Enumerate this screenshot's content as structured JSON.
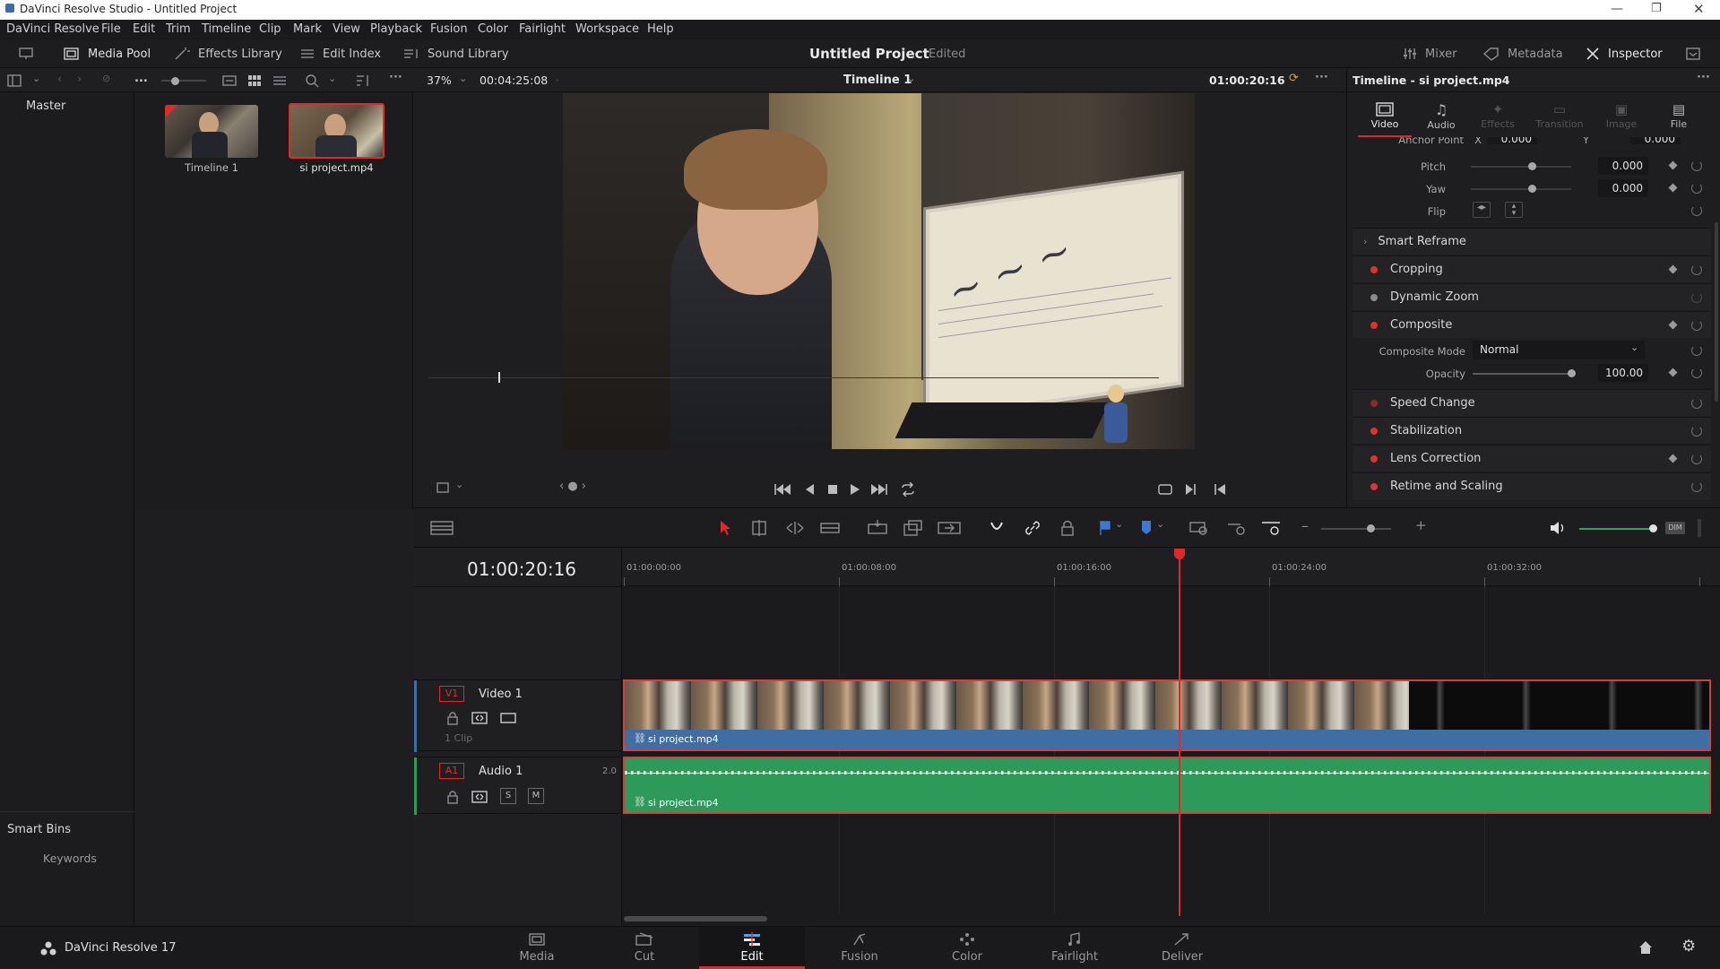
{
  "window": {
    "title": "DaVinci Resolve Studio - Untitled Project"
  },
  "menu": [
    "DaVinci Resolve",
    "File",
    "Edit",
    "Trim",
    "Timeline",
    "Clip",
    "Mark",
    "View",
    "Playback",
    "Fusion",
    "Color",
    "Fairlight",
    "Workspace",
    "Help"
  ],
  "toolbar": {
    "media_pool": "Media Pool",
    "effects_library": "Effects Library",
    "edit_index": "Edit Index",
    "sound_library": "Sound Library",
    "project_title": "Untitled Project",
    "project_status": "Edited",
    "mixer": "Mixer",
    "metadata": "Metadata",
    "inspector": "Inspector"
  },
  "media_pool": {
    "ellipsis": "...",
    "master_bin": "Master",
    "clips": [
      {
        "name": "Timeline 1"
      },
      {
        "name": "si project.mp4"
      }
    ],
    "smart_bins": "Smart Bins",
    "keywords": "Keywords"
  },
  "viewer": {
    "zoom": "37%",
    "duration": "00:04:25:08",
    "timeline_name": "Timeline 1",
    "timecode": "01:00:20:16"
  },
  "inspector": {
    "title": "Timeline - si project.mp4",
    "tabs": [
      "Video",
      "Audio",
      "Effects",
      "Transition",
      "Image",
      "File"
    ],
    "anchor_point": {
      "label": "Anchor Point",
      "x_label": "X",
      "x": "0.000",
      "y_label": "Y",
      "y": "0.000"
    },
    "pitch": {
      "label": "Pitch",
      "value": "0.000"
    },
    "yaw": {
      "label": "Yaw",
      "value": "0.000"
    },
    "flip": {
      "label": "Flip"
    },
    "smart_reframe": "Smart Reframe",
    "sections": [
      "Cropping",
      "Dynamic Zoom",
      "Composite",
      "Speed Change",
      "Stabilization",
      "Lens Correction",
      "Retime and Scaling"
    ],
    "composite_mode": {
      "label": "Composite Mode",
      "value": "Normal"
    },
    "opacity": {
      "label": "Opacity",
      "value": "100.00"
    }
  },
  "timeline": {
    "timecode": "01:00:20:16",
    "ruler": [
      "01:00:00:00",
      "01:00:08:00",
      "01:00:16:00",
      "01:00:24:00",
      "01:00:32:00"
    ],
    "video_track": {
      "id": "V1",
      "name": "Video 1",
      "clip_count": "1 Clip",
      "clip_name": "si project.mp4"
    },
    "audio_track": {
      "id": "A1",
      "name": "Audio 1",
      "channels": "2.0",
      "solo": "S",
      "mute": "M",
      "clip_name": "si project.mp4"
    }
  },
  "bottom": {
    "app_name": "DaVinci Resolve 17",
    "pages": [
      "Media",
      "Cut",
      "Edit",
      "Fusion",
      "Color",
      "Fairlight",
      "Deliver"
    ],
    "active_page": "Edit"
  },
  "colors": {
    "accent_red": "#e02a2a",
    "video_clip": "#3e6ea4",
    "audio_clip": "#2e9a5a"
  }
}
